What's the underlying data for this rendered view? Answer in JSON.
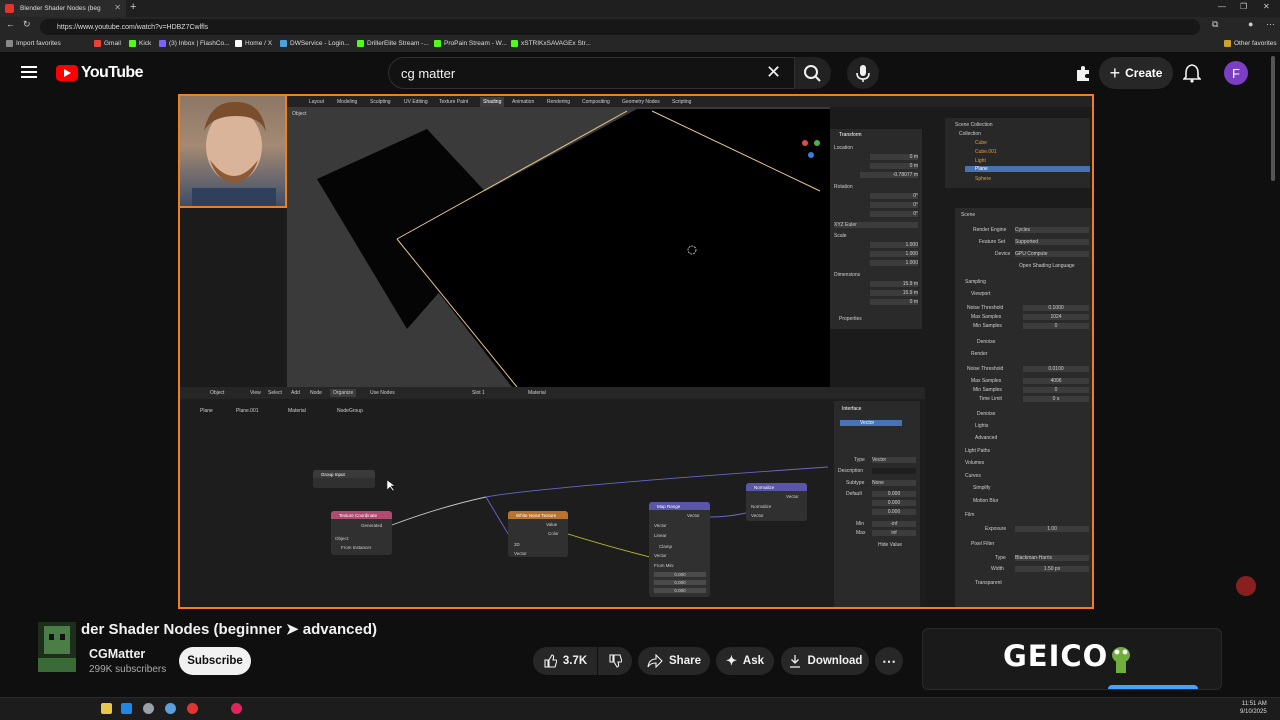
{
  "browser": {
    "tab_title": "Blender Shader Nodes (beg",
    "url": "https://www.youtube.com/watch?v=HDBZ7Cwlfls",
    "bookmarks": [
      {
        "label": "Import favorites",
        "color": "#888888"
      },
      {
        "label": "Gmail",
        "color": "#ea4335"
      },
      {
        "label": "Kick",
        "color": "#53fc18"
      },
      {
        "label": "(3) Inbox | FlashCo...",
        "color": "#7b61ff"
      },
      {
        "label": "Home / X",
        "color": "#ffffff"
      },
      {
        "label": "DWService - Login...",
        "color": "#4aa3df"
      },
      {
        "label": "DrillerElite Stream -...",
        "color": "#53fc18"
      },
      {
        "label": "ProPain Stream - W...",
        "color": "#53fc18"
      },
      {
        "label": "xSTRIKxSAVAGEx Str...",
        "color": "#53fc18"
      }
    ],
    "other_favorites": "Other favorites"
  },
  "youtube": {
    "logo_text": "YouTube",
    "search_value": "cg matter",
    "create_label": "Create",
    "avatar_letter": "F"
  },
  "video": {
    "title": "der Shader Nodes (beginner ➤ advanced)",
    "blender": {
      "workspace_tabs": [
        "Layout",
        "Modeling",
        "Sculpting",
        "UV Editing",
        "Texture Paint",
        "Shading",
        "Animation",
        "Rendering",
        "Compositing",
        "Geometry Nodes",
        "Scripting"
      ],
      "active_tab": "Shading",
      "transform_title": "Transform",
      "location_label": "Location",
      "rotation_label": "Rotation",
      "scale_label": "Scale",
      "dimensions_label": "Dimensions",
      "properties_label": "Properties",
      "rotation_mode": "XYZ Euler",
      "location_values": [
        "0 m",
        "0 m",
        "-0.78077 m"
      ],
      "rotation_values": [
        "0°",
        "0°",
        "0°"
      ],
      "scale_values": [
        "1.000",
        "1.000",
        "1.000"
      ],
      "dimension_values": [
        "15.9 m",
        "15.9 m",
        "0 m"
      ],
      "outliner": {
        "title": "Scene Collection",
        "items": [
          "Collection",
          "Cube",
          "Cube.001",
          "Light",
          "Plane",
          "Sphere"
        ]
      },
      "render": {
        "scene_label": "Scene",
        "render_engine_label": "Render Engine",
        "render_engine": "Cycles",
        "feature_set_label": "Feature Set",
        "feature_set": "Supported",
        "device_label": "Device",
        "device": "GPU Compute",
        "osl_label": "Open Shading Language",
        "sampling_label": "Sampling",
        "viewport_label": "Viewport",
        "noise_threshold_label": "Noise Threshold",
        "viewport_noise_threshold": "0.1000",
        "max_samples_label": "Max Samples",
        "viewport_max_samples": "1024",
        "min_samples_label": "Min Samples",
        "viewport_min_samples": "0",
        "denoise_label": "Denoise",
        "render_label": "Render",
        "render_noise_threshold": "0.0100",
        "render_max_samples": "4096",
        "render_min_samples": "0",
        "time_limit_label": "Time Limit",
        "time_limit": "0 s",
        "lights_label": "Lights",
        "advanced_label": "Advanced",
        "light_paths_label": "Light Paths",
        "volumes_label": "Volumes",
        "curves_label": "Curves",
        "simplify_label": "Simplify",
        "motion_blur_label": "Motion Blur",
        "film_label": "Film",
        "exposure_label": "Exposure",
        "exposure": "1.00",
        "pixel_filter_label": "Pixel Filter",
        "type_label": "Type",
        "filter_type": "Blackman-Harris",
        "width_label": "Width",
        "filter_width": "1.50 px",
        "transparent_label": "Transparent"
      },
      "node_editor": {
        "menus": [
          "Object",
          "View",
          "Select",
          "Add",
          "Node"
        ],
        "organize": "Organize",
        "use_nodes": "Use Nodes",
        "slot": "Slot 1",
        "material": "Material",
        "breadcrumb": [
          "Plane",
          "Plane.001",
          "Material",
          "NodeGroup"
        ],
        "group_input": "Group Input",
        "texture_coordinate": {
          "title": "Texture Coordinate",
          "generated": "Generated",
          "object": "Object:",
          "from_instancer": "From Instancer"
        },
        "white_noise": {
          "title": "White Noise Texture",
          "value": "Value",
          "color": "Color",
          "dim": "3D",
          "vector": "Vector"
        },
        "map_range": {
          "title": "Map Range",
          "vector": "Vector",
          "dtype": "Vector",
          "interp": "Linear",
          "clamp": "Clamp",
          "vector_in": "Vector",
          "from_min": "From Min:",
          "vals": [
            "0.000",
            "0.000",
            "0.000"
          ]
        },
        "normalize": {
          "title": "Normalize",
          "vector_out": "Vector",
          "op": "Normalize",
          "vector_in": "Vector"
        },
        "interface": {
          "title": "Interface",
          "socket": "Vector",
          "type_label": "Type",
          "type": "Vector",
          "description_label": "Description",
          "subtype_label": "Subtype",
          "subtype": "None",
          "default_label": "Default",
          "default_vals": [
            "0.000",
            "0.000",
            "0.000"
          ],
          "min_label": "Min",
          "min": "-inf",
          "max_label": "Max",
          "max": "inf",
          "hide_value": "Hide Value"
        }
      }
    }
  },
  "channel": {
    "name": "CGMatter",
    "subscribers": "299K subscribers",
    "subscribe_label": "Subscribe"
  },
  "actions": {
    "likes": "3.7K",
    "share": "Share",
    "ask": "Ask",
    "download": "Download"
  },
  "ad": {
    "brand": "GEICO"
  },
  "taskbar": {
    "time": "11:51 AM",
    "date": "9/10/2025"
  },
  "colors": {
    "accent": "#ff0000",
    "video_border": "#f07f1c",
    "blender_select": "#4772b3"
  }
}
